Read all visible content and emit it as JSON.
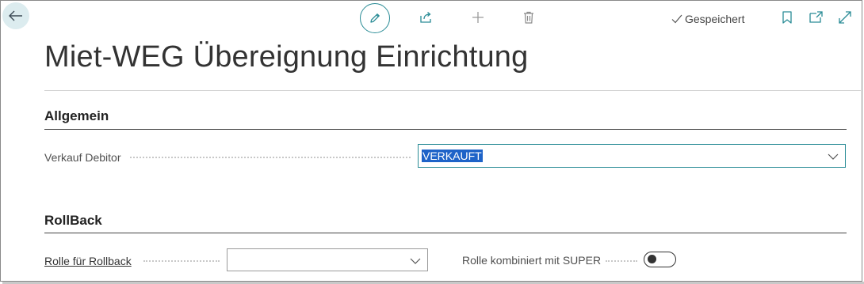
{
  "toolbar": {
    "back_icon": "arrow-left-icon",
    "edit_icon": "pencil-icon",
    "share_icon": "share-icon",
    "add_icon": "plus-icon",
    "delete_icon": "trash-icon",
    "saved_label": "Gespeichert",
    "bookmark_icon": "bookmark-icon",
    "popout_icon": "open-in-new-window-icon",
    "expand_icon": "expand-icon"
  },
  "page": {
    "title": "Miet-WEG Übereignung Einrichtung"
  },
  "sections": {
    "general": {
      "title": "Allgemein",
      "fields": {
        "verkauf_debitor": {
          "label": "Verkauf Debitor",
          "value": "VERKAUFT"
        }
      }
    },
    "rollback": {
      "title": "RollBack",
      "fields": {
        "rolle": {
          "label": "Rolle für Rollback",
          "value": ""
        },
        "super": {
          "label": "Rolle kombiniert mit SUPER",
          "toggle_on": false
        }
      }
    }
  },
  "colors": {
    "accent": "#2a8c96",
    "selection": "#1e63c8"
  }
}
